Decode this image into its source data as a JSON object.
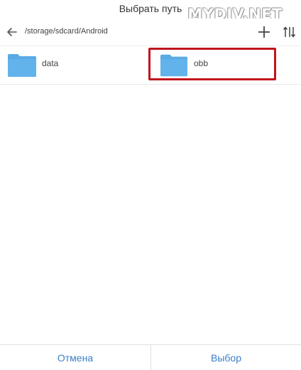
{
  "dialog": {
    "title": "Выбрать путь",
    "watermark": "MYDIV.NET"
  },
  "pathbar": {
    "path": "/storage/sdcard/Android",
    "icons": [
      "back-arrow-icon",
      "add-icon",
      "sort-icon"
    ]
  },
  "folders": [
    {
      "name": "data",
      "icon": "folder-icon"
    },
    {
      "name": "obb",
      "icon": "folder-icon",
      "highlighted": true
    }
  ],
  "colors": {
    "folder": "#5aaae6",
    "accent": "#3a7fc8",
    "highlight": "#c0141c"
  },
  "footer": {
    "cancel_label": "Отмена",
    "select_label": "Выбор"
  }
}
